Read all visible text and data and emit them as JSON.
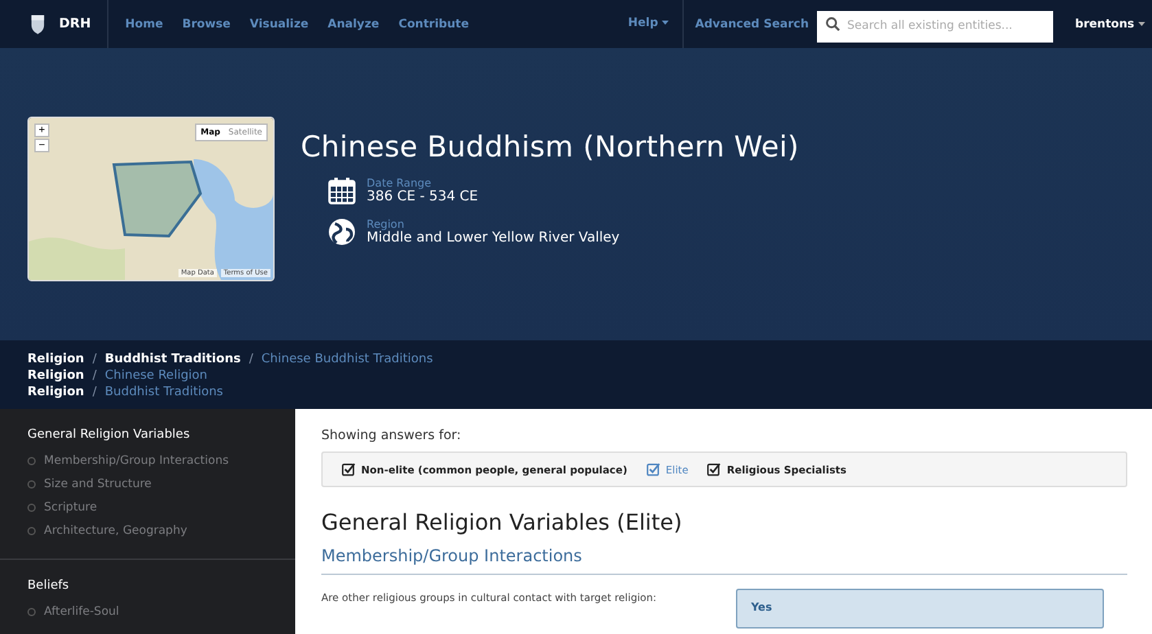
{
  "navbar": {
    "brand": "DRH",
    "links": [
      {
        "label": "Home"
      },
      {
        "label": "Browse"
      },
      {
        "label": "Visualize"
      },
      {
        "label": "Analyze"
      },
      {
        "label": "Contribute"
      }
    ],
    "help": "Help",
    "advanced_search": "Advanced Search",
    "search": {
      "placeholder": "Search all existing entities..."
    },
    "user": "brentons"
  },
  "hero": {
    "title": "Chinese Buddhism (Northern Wei)",
    "map": {
      "zoom_in": "+",
      "zoom_out": "−",
      "types": [
        {
          "label": "Map",
          "selected": true
        },
        {
          "label": "Satellite",
          "selected": false
        }
      ],
      "footer": [
        "Map Data",
        "Terms of Use"
      ]
    },
    "facts": [
      {
        "kind": "date",
        "label": "Date Range",
        "value": "386 CE - 534 CE"
      },
      {
        "kind": "region",
        "label": "Region",
        "value": "Middle and Lower Yellow River Valley"
      }
    ]
  },
  "breadcrumb_separator": "/",
  "breadcrumbs": [
    [
      "Religion",
      "Buddhist Traditions",
      "Chinese Buddhist Traditions"
    ],
    [
      "Religion",
      "Chinese Religion"
    ],
    [
      "Religion",
      "Buddhist Traditions"
    ]
  ],
  "sidebar": {
    "sections": [
      {
        "title": "General Religion Variables",
        "items": [
          "Membership/Group Interactions",
          "Size and Structure",
          "Scripture",
          "Architecture, Geography"
        ]
      },
      {
        "title": "Beliefs",
        "items": [
          "Afterlife-Soul"
        ]
      }
    ]
  },
  "main": {
    "showing_label": "Showing answers for:",
    "filters": [
      {
        "label": "Non-elite (common people, general populace)",
        "selected": false
      },
      {
        "label": "Elite",
        "selected": true
      },
      {
        "label": "Religious Specialists",
        "selected": false
      }
    ],
    "heading": "General Religion Variables (Elite)",
    "subheading": "Membership/Group Interactions",
    "questions": [
      {
        "question": "Are other religious groups in cultural contact with target religion:",
        "answer": "Yes"
      }
    ]
  }
}
